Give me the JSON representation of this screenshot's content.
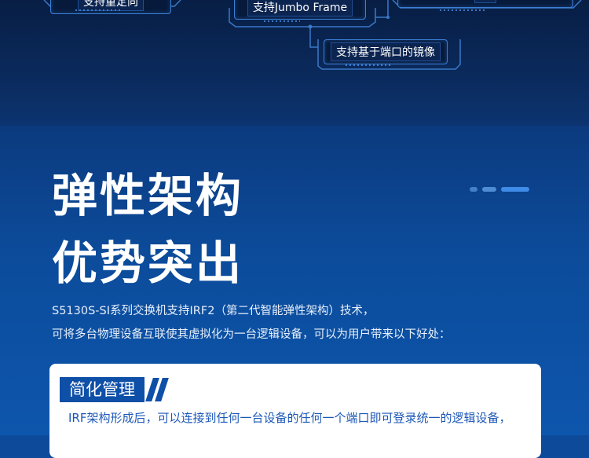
{
  "features": {
    "tag_left": "支持重定向",
    "tag_center": "支持Jumbo Frame",
    "tag_mirror": "支持基于端口的镜像"
  },
  "headline": {
    "line1": "弹性架构",
    "line2": "优势突出"
  },
  "intro": {
    "line1": "S5130S-SI系列交换机支持IRF2（第二代智能弹性架构）技术，",
    "line2": "可将多台物理设备互联使其虚拟化为一台逻辑设备，可以为用户带来以下好处："
  },
  "card": {
    "title": "简化管理",
    "text": "IRF架构形成后，可以连接到任何一台设备的任何一个端口即可登录统一的逻辑设备，"
  },
  "colors": {
    "accent": "#0e4fa8",
    "text_blue": "#1d58b8",
    "bg_dark": "#081e44"
  }
}
